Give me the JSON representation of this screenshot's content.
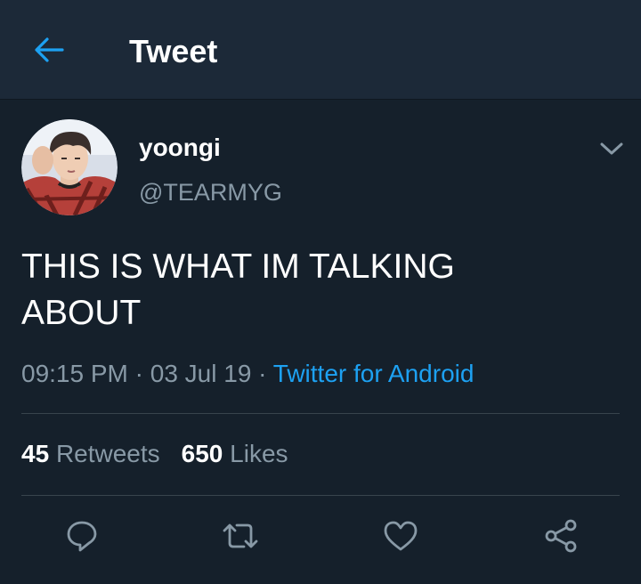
{
  "header": {
    "title": "Tweet",
    "back_icon": "arrow-left-icon"
  },
  "tweet": {
    "display_name": "yoongi",
    "handle": "@TEARMYG",
    "text_line1": "THIS IS WHAT IM TALKING",
    "text_line2": "ABOUT",
    "time": "09:15 PM",
    "separator": "·",
    "date": "03 Jul 19",
    "source": "Twitter for Android"
  },
  "stats": {
    "retweets_count": "45",
    "retweets_label": "Retweets",
    "likes_count": "650",
    "likes_label": "Likes"
  },
  "actions": [
    "reply-icon",
    "retweet-icon",
    "like-icon",
    "share-icon"
  ],
  "colors": {
    "background": "#15202b",
    "header_background": "#1c2938",
    "accent": "#1da1f2",
    "secondary_text": "#8899a6",
    "divider": "#38444d"
  }
}
